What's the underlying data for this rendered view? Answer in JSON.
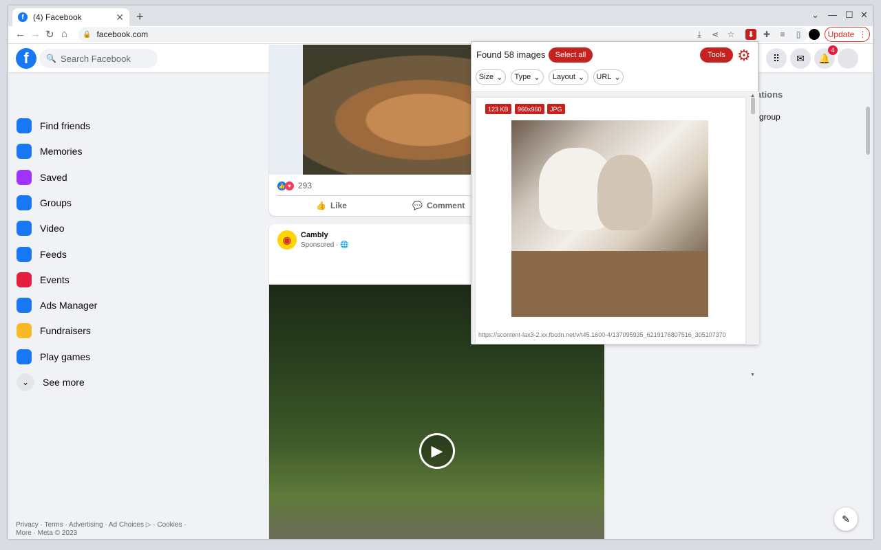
{
  "browser": {
    "tab_title": "(4) Facebook",
    "tab_close": "✕",
    "new_tab": "+",
    "url": "facebook.com",
    "update_label": "Update",
    "win_min": "⌄",
    "win_minimize": "—",
    "win_maximize": "☐",
    "win_close": "✕"
  },
  "facebook": {
    "logo_letter": "f",
    "search_placeholder": "Search Facebook",
    "notification_count": "4",
    "sidebar": [
      {
        "label": "Find friends",
        "icon": "friends-icon",
        "color": "#1877f2"
      },
      {
        "label": "Memories",
        "icon": "memories-icon",
        "color": "#1877f2"
      },
      {
        "label": "Saved",
        "icon": "saved-icon",
        "color": "#a033ff"
      },
      {
        "label": "Groups",
        "icon": "groups-icon",
        "color": "#1877f2"
      },
      {
        "label": "Video",
        "icon": "video-icon",
        "color": "#1877f2"
      },
      {
        "label": "Feeds",
        "icon": "feeds-icon",
        "color": "#1877f2"
      },
      {
        "label": "Events",
        "icon": "events-icon",
        "color": "#e41e3f"
      },
      {
        "label": "Ads Manager",
        "icon": "ads-manager-icon",
        "color": "#1877f2"
      },
      {
        "label": "Fundraisers",
        "icon": "fundraisers-icon",
        "color": "#f7b928"
      },
      {
        "label": "Play games",
        "icon": "play-games-icon",
        "color": "#1877f2"
      },
      {
        "label": "See more",
        "icon": "see-more-icon",
        "color": "#e4e6eb"
      }
    ],
    "footer": "Privacy · Terms · Advertising · Ad Choices ▷ · Cookies · More · Meta © 2023",
    "post1": {
      "reaction_count": "293",
      "like_label": "Like",
      "comment_label": "Comment"
    },
    "post2": {
      "author": "Cambly",
      "subtitle": "Sponsored · 🌐"
    },
    "right_col": {
      "heading_fragment": "ations",
      "item_fragment": "group"
    }
  },
  "extension_popup": {
    "found_text": "Found 58 images",
    "select_all": "Select all",
    "tools": "Tools",
    "filters": [
      "Size",
      "Type",
      "Layout",
      "URL"
    ],
    "image": {
      "size": "123 KB",
      "dimensions": "960x960",
      "format": "JPG",
      "url": "https://scontent-lax3-2.xx.fbcdn.net/v/t45.1600-4/137095935_6219176807516_305107370"
    }
  },
  "colors": {
    "facebook_blue": "#1877f2",
    "extension_red": "#c5221f"
  }
}
